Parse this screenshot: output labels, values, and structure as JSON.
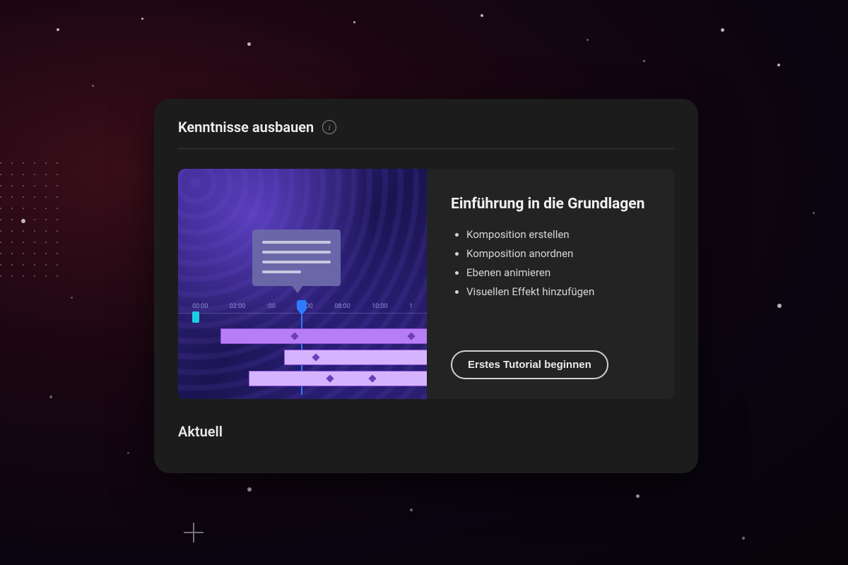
{
  "card": {
    "header_title": "Kenntnisse ausbauen",
    "section_label": "Aktuell"
  },
  "tutorial": {
    "title": "Einführung in die Grundlagen",
    "bullets": [
      "Komposition erstellen",
      "Komposition anordnen",
      "Ebenen animieren",
      "Visuellen Effekt hinzufügen"
    ],
    "cta_label": "Erstes Tutorial beginnen",
    "thumbnail": {
      "time_ticks": [
        "00:00",
        "02:00",
        ":00",
        "06:00",
        "08:00",
        "10:00",
        "1"
      ]
    }
  },
  "icons": {
    "info_glyph": "i"
  }
}
